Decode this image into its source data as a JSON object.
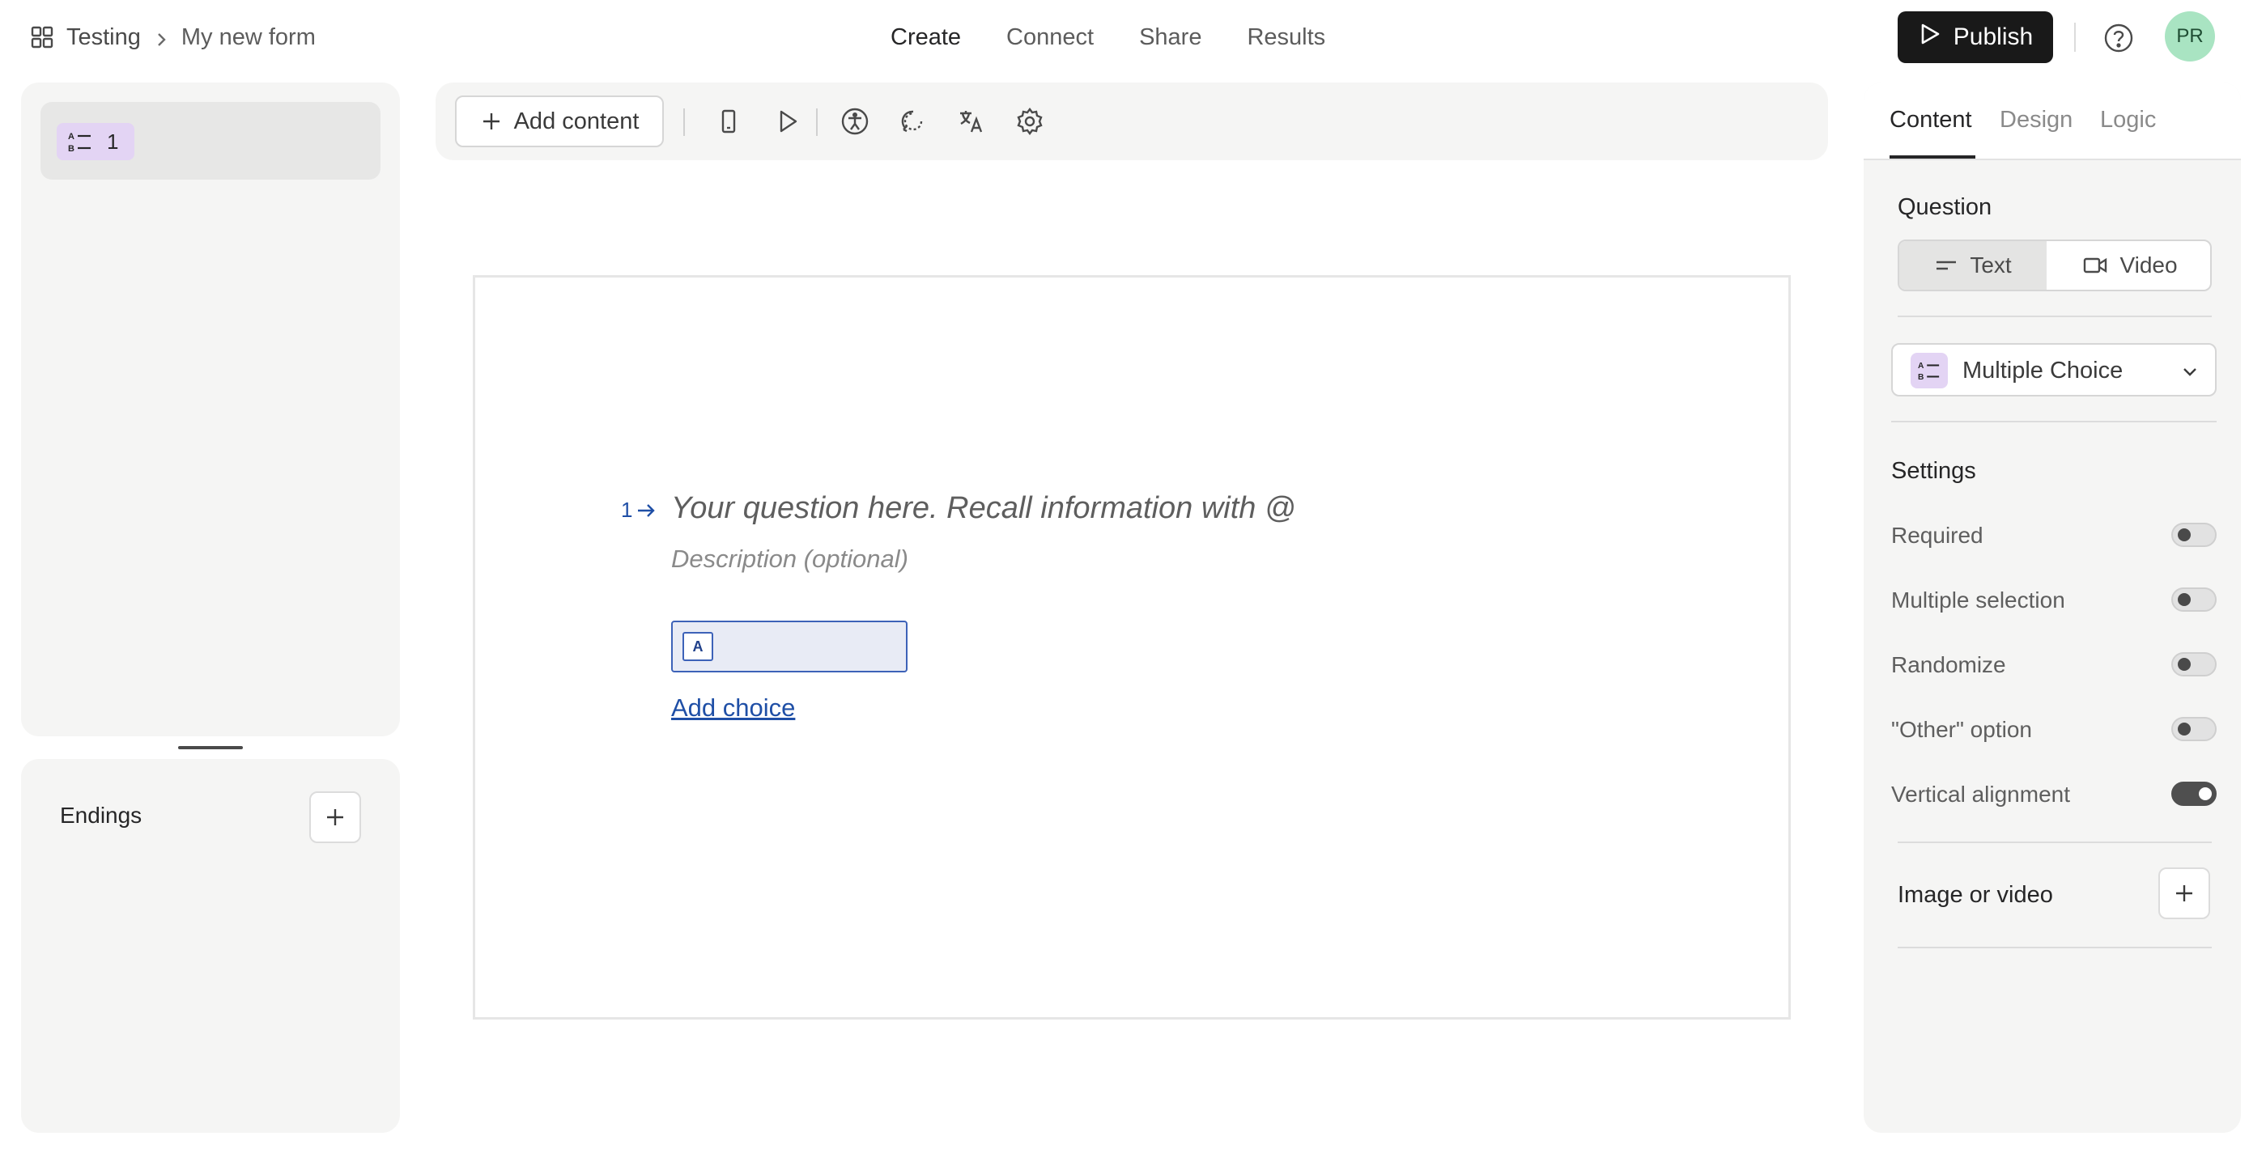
{
  "header": {
    "breadcrumb": {
      "workspace": "Testing",
      "form": "My new form"
    },
    "nav": {
      "create": "Create",
      "connect": "Connect",
      "share": "Share",
      "results": "Results"
    },
    "publish_label": "Publish",
    "avatar_initials": "PR"
  },
  "sidebar": {
    "question_item": {
      "number": "1",
      "icon": "multiple-choice-icon"
    },
    "endings_label": "Endings"
  },
  "toolbar": {
    "add_content_label": "Add content",
    "icons": [
      "mobile-preview-icon",
      "play-icon",
      "accessibility-icon",
      "redirect-icon",
      "translate-icon",
      "settings-icon"
    ]
  },
  "canvas": {
    "question_number": "1",
    "question_placeholder": "Your question here. Recall information with @",
    "description_placeholder": "Description (optional)",
    "choices": [
      {
        "key": "A",
        "text": ""
      }
    ],
    "add_choice_label": "Add choice"
  },
  "panel": {
    "tabs": {
      "content": "Content",
      "design": "Design",
      "logic": "Logic"
    },
    "question_label": "Question",
    "question_format": {
      "text": "Text",
      "video": "Video",
      "selected": "Text"
    },
    "question_type": "Multiple Choice",
    "settings_label": "Settings",
    "settings": {
      "required": {
        "label": "Required",
        "on": false
      },
      "multiple_selection": {
        "label": "Multiple selection",
        "on": false
      },
      "randomize": {
        "label": "Randomize",
        "on": false
      },
      "other_option": {
        "label": "\"Other\" option",
        "on": false
      },
      "vertical_alignment": {
        "label": "Vertical alignment",
        "on": true
      }
    },
    "media_label": "Image or video"
  },
  "colors": {
    "accent_blue": "#1f4fa6",
    "badge_purple": "#e3d4f4",
    "avatar_green": "#a9e4c2",
    "publish_bg": "#191919"
  }
}
